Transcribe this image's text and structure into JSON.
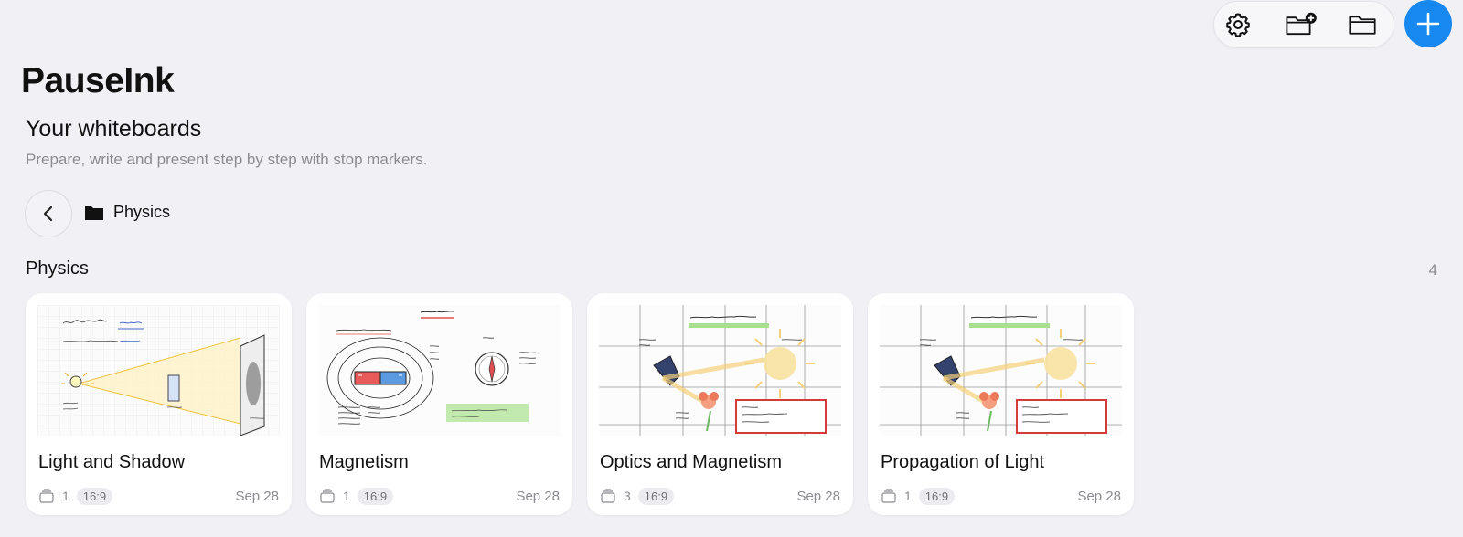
{
  "app": {
    "title": "PauseInk"
  },
  "header": {
    "title": "Your whiteboards",
    "subtitle": "Prepare, write and present step by step with stop markers."
  },
  "toolbar": {
    "icons": [
      "gear-icon",
      "folder-add-icon",
      "folder-icon"
    ],
    "add_icon": "plus-icon",
    "accent": "#1688f0"
  },
  "breadcrumb": {
    "folder": "Physics"
  },
  "group": {
    "title": "Physics",
    "count": "4"
  },
  "boards": [
    {
      "title": "Light and Shadow",
      "pages": "1",
      "ratio": "16:9",
      "date": "Sep 28"
    },
    {
      "title": "Magnetism",
      "pages": "1",
      "ratio": "16:9",
      "date": "Sep 28"
    },
    {
      "title": "Optics and Magnetism",
      "pages": "3",
      "ratio": "16:9",
      "date": "Sep 28"
    },
    {
      "title": "Propagation of Light",
      "pages": "1",
      "ratio": "16:9",
      "date": "Sep 28"
    }
  ]
}
